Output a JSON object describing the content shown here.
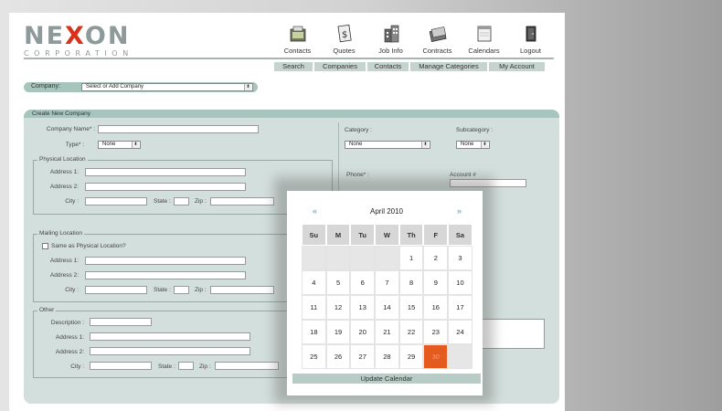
{
  "logo": {
    "main_before": "NE",
    "main_x": "X",
    "main_after": "ON",
    "sub": "CORPORATION"
  },
  "top_nav": [
    {
      "label": "Contacts",
      "icon": "contacts-icon"
    },
    {
      "label": "Quotes",
      "icon": "quotes-icon"
    },
    {
      "label": "Job Info",
      "icon": "job-info-icon"
    },
    {
      "label": "Contracts",
      "icon": "contracts-icon"
    },
    {
      "label": "Calendars",
      "icon": "calendars-icon"
    },
    {
      "label": "Logout",
      "icon": "logout-icon"
    }
  ],
  "sub_nav": [
    "Search",
    "Companies",
    "Contacts",
    "Manage Categories",
    "My Account"
  ],
  "company_bar": {
    "label": "Company:",
    "select_value": "Select or Add Company"
  },
  "panel": {
    "title": "Create New Company",
    "company_name_label": "Company Name* :",
    "type_label": "Type* :",
    "type_value": "None",
    "category_label": "Category :",
    "category_value": "None",
    "subcategory_label": "Subcategory :",
    "subcategory_value": "None",
    "phone_label": "Phone* :",
    "account_label": "Account #",
    "physical": {
      "legend": "Physical Location",
      "address1": "Address 1:",
      "address2": "Address 2:",
      "city": "City :",
      "state": "State :",
      "zip": "Zip :"
    },
    "mailing": {
      "legend": "Mailing Location",
      "same_as": "Same as Physical Location?",
      "address1": "Address 1:",
      "address2": "Address 2:",
      "city": "City :",
      "state": "State :",
      "zip": "Zip :"
    },
    "other": {
      "legend": "Other",
      "description": "Description :",
      "address1": "Address 1:",
      "address2": "Address 2:",
      "city": "City :",
      "state": "State :",
      "zip": "Zip :"
    }
  },
  "calendar": {
    "prev": "«",
    "next": "»",
    "title": "April 2010",
    "days_of_week": [
      "Su",
      "M",
      "Tu",
      "W",
      "Th",
      "F",
      "Sa"
    ],
    "weeks": [
      [
        "",
        "",
        "",
        "",
        "1",
        "2",
        "3"
      ],
      [
        "4",
        "5",
        "6",
        "7",
        "8",
        "9",
        "10"
      ],
      [
        "11",
        "12",
        "13",
        "14",
        "15",
        "16",
        "17"
      ],
      [
        "18",
        "19",
        "20",
        "21",
        "22",
        "23",
        "24"
      ],
      [
        "25",
        "26",
        "27",
        "28",
        "29",
        "30",
        ""
      ]
    ],
    "selected_day": "30",
    "update_button": "Update Calendar"
  },
  "colors": {
    "accent_red": "#d9311a",
    "panel_bg": "#d3dfdc",
    "panel_header": "#a7c4bd",
    "today_highlight": "#e55a1f",
    "link_blue": "#2aa3c9"
  }
}
